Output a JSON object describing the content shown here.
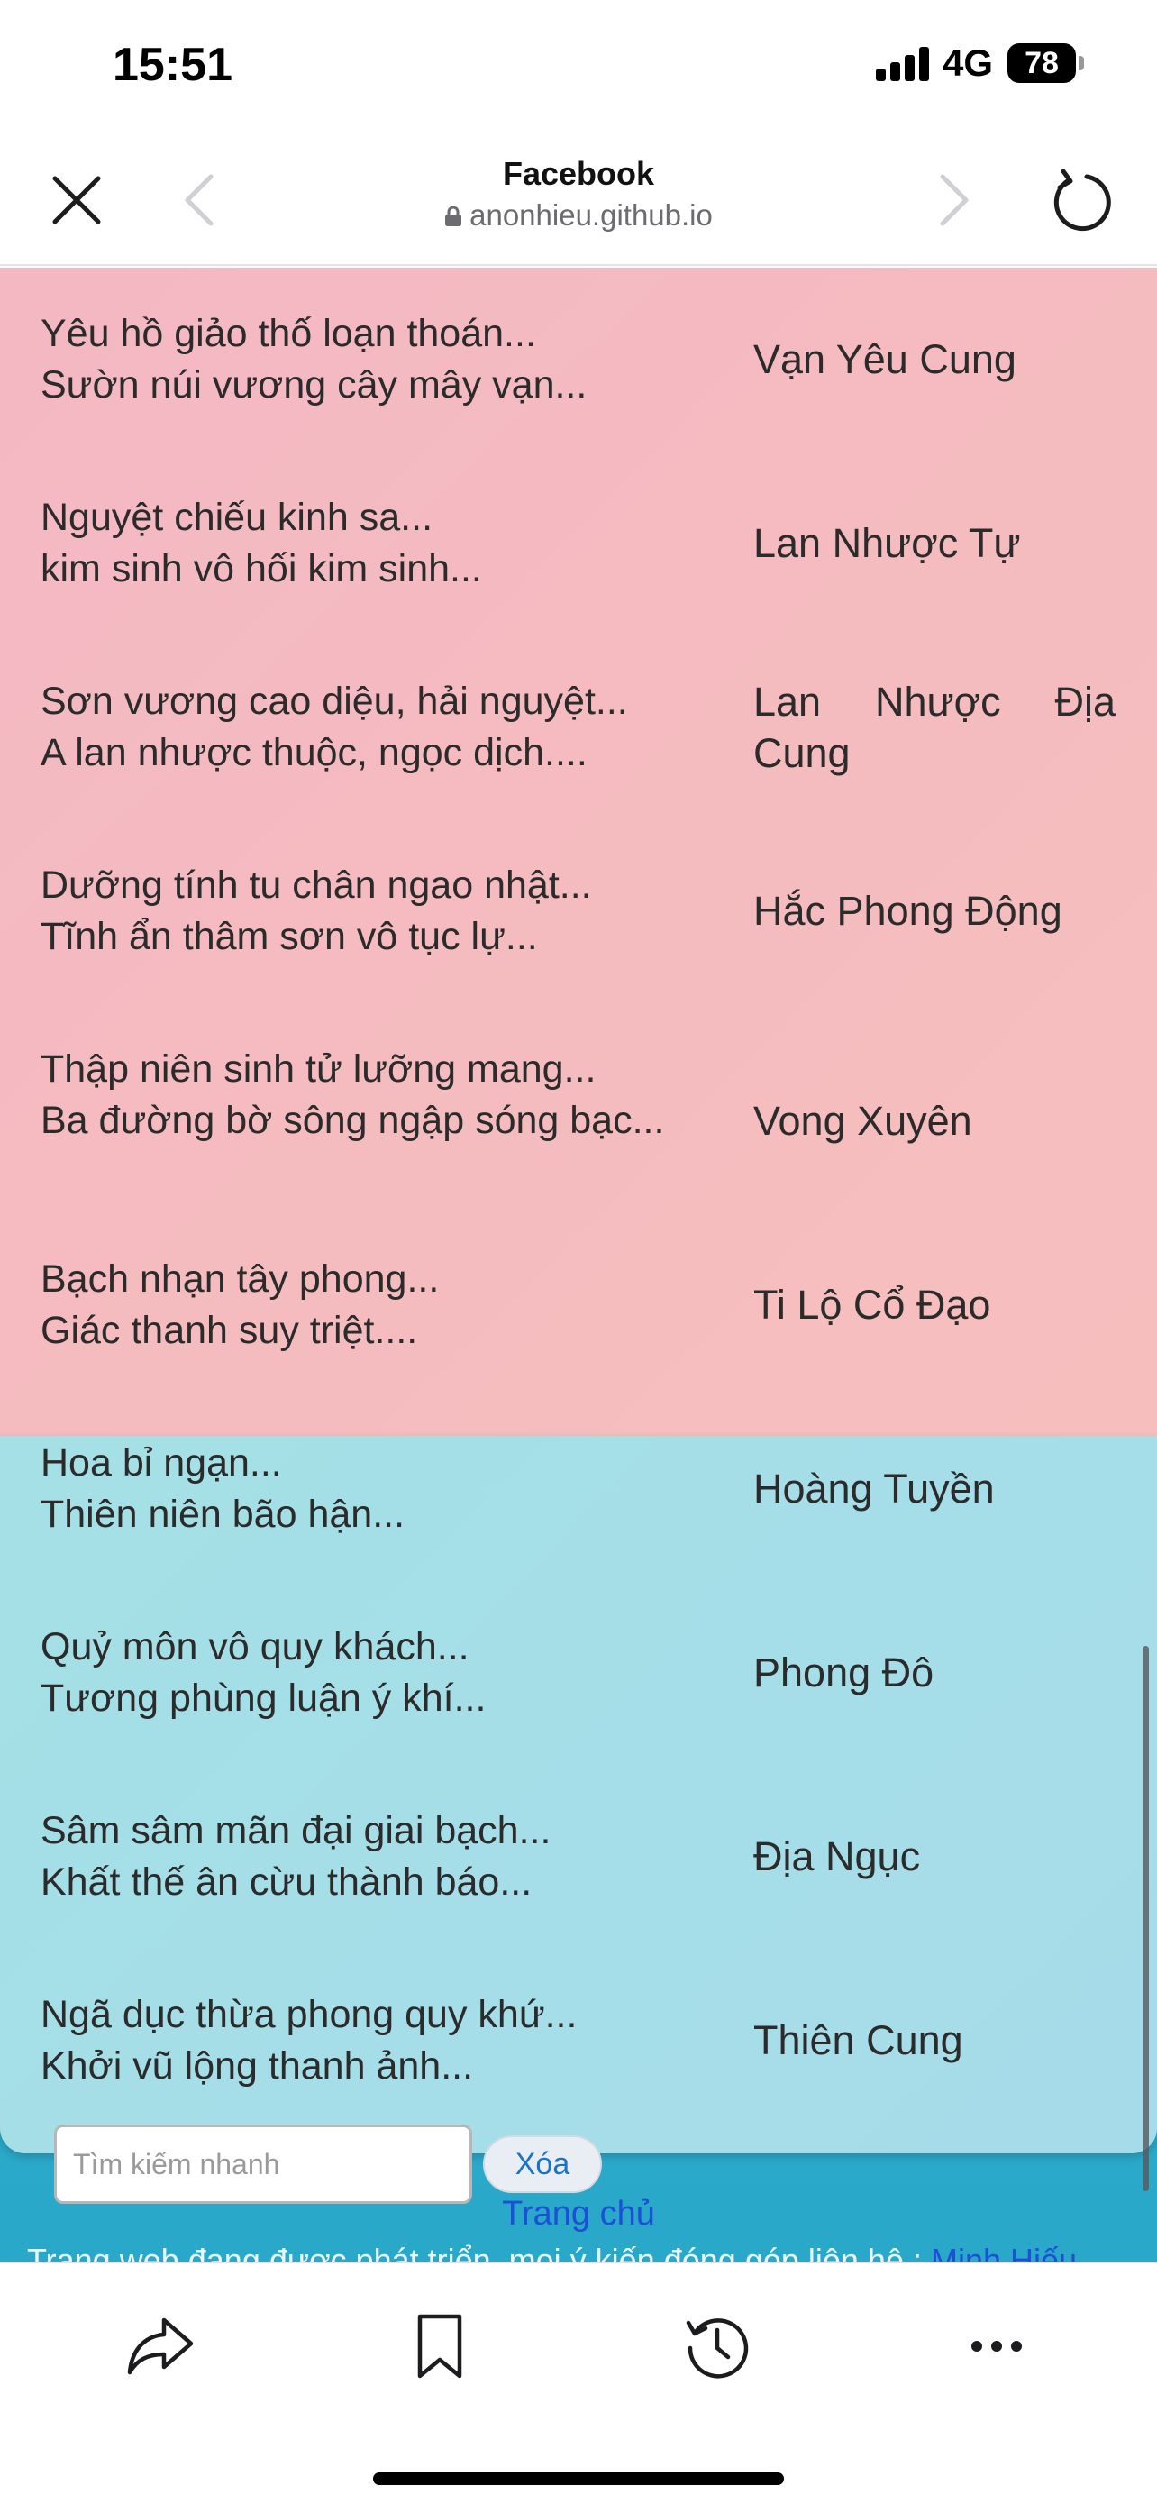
{
  "status_bar": {
    "time": "15:51",
    "network": "4G",
    "battery": "78"
  },
  "browser": {
    "title": "Facebook",
    "url": "anonhieu.github.io"
  },
  "entries": [
    {
      "verse_1": "Yêu hồ giảo thố loạn thoán...",
      "verse_2": "Sườn núi vương cây mây vạn...",
      "place": "Vạn Yêu Cung"
    },
    {
      "verse_1": "Nguyệt chiếu kinh sa...",
      "verse_2": "kim sinh vô hối kim sinh...",
      "place": "Lan Nhược Tự"
    },
    {
      "verse_1": "Sơn vương cao diệu, hải nguyệt...",
      "verse_2": "A lan nhược thuộc, ngọc dịch....",
      "place": "Lan Nhược Địa Cung"
    },
    {
      "verse_1": "Dưỡng tính tu chân ngao nhật...",
      "verse_2": "Tĩnh ẩn thâm sơn vô tục lự...",
      "place": "Hắc Phong Động"
    },
    {
      "verse_1": "Thập niên sinh tử lưỡng mang...",
      "verse_2": "Ba đường bờ sông ngập sóng bạc...",
      "place": "Vong Xuyên"
    },
    {
      "verse_1": "Bạch nhạn tây phong...",
      "verse_2": "Giác thanh suy triệt....",
      "place": "Ti Lộ Cổ Đạo"
    },
    {
      "verse_1": "Hoa bỉ ngạn...",
      "verse_2": "Thiên niên bão hận...",
      "place": "Hoàng Tuyền"
    },
    {
      "verse_1": "Quỷ môn vô quy khách...",
      "verse_2": "Tương phùng luận ý khí...",
      "place": "Phong Đô"
    },
    {
      "verse_1": "Sâm sâm mãn đại giai bạch...",
      "verse_2": "Khất thế ân cừu thành báo...",
      "place": "Địa Ngục"
    },
    {
      "verse_1": "Ngã dục thừa phong quy khứ...",
      "verse_2": "Khởi vũ lộng thanh ảnh...",
      "place": "Thiên Cung"
    }
  ],
  "search": {
    "placeholder": "Tìm kiếm nhanh",
    "clear_label": "Xóa"
  },
  "home_link": "Trang chủ",
  "footer": {
    "text": "Trang web đang được phát triển, mọi ý kiến đóng góp liên hệ : ",
    "contact_link": "Minh Hiếu"
  },
  "toolbar": {
    "icons": [
      "share-icon",
      "bookmark-icon",
      "history-icon",
      "more-icon"
    ]
  },
  "colors": {
    "pink_section": "#f4b8c3",
    "blue_section": "#a4e0e6",
    "page_background": "#26b7cf",
    "link": "#1e4fd8"
  }
}
